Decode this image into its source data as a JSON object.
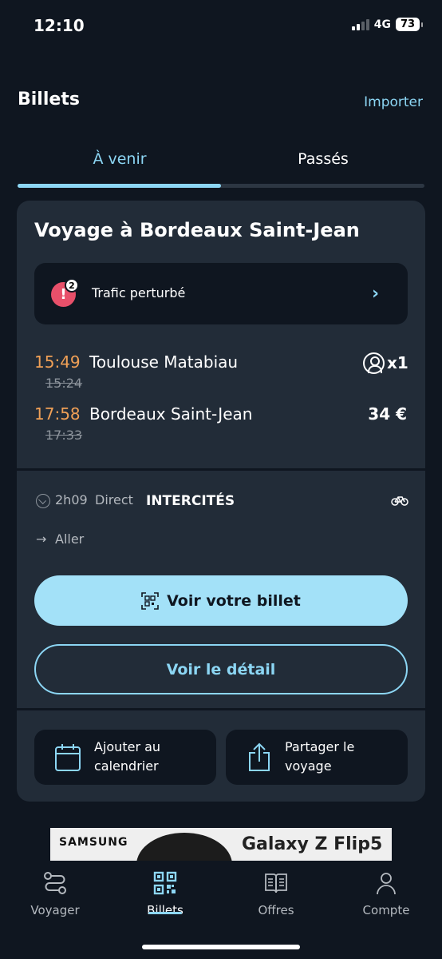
{
  "status_bar": {
    "time": "12:10",
    "network": "4G",
    "battery": "73"
  },
  "header": {
    "title": "Billets",
    "import_label": "Importer"
  },
  "tabs": [
    {
      "label": "À venir",
      "active": true
    },
    {
      "label": "Passés",
      "active": false
    }
  ],
  "trip": {
    "title": "Voyage à Bordeaux Saint-Jean",
    "alert": {
      "count": "2",
      "text": "Trafic perturbé"
    },
    "departure": {
      "time": "15:49",
      "scheduled_time": "15:24",
      "station": "Toulouse Matabiau"
    },
    "arrival": {
      "time": "17:58",
      "scheduled_time": "17:33",
      "station": "Bordeaux Saint-Jean"
    },
    "passengers": "x1",
    "price": "34 €",
    "duration": "2h09",
    "type": "Direct",
    "operator": "INTERCITÉS",
    "direction": "Aller",
    "primary_button": "Voir votre billet",
    "secondary_button": "Voir le détail",
    "actions": {
      "calendar": "Ajouter au calendrier",
      "share": "Partager le voyage"
    }
  },
  "ad": {
    "brand": "SAMSUNG",
    "product": "Galaxy Z Flip5"
  },
  "bottom_nav": [
    {
      "label": "Voyager",
      "icon": "route-icon"
    },
    {
      "label": "Billets",
      "icon": "qr-code-icon",
      "active": true
    },
    {
      "label": "Offres",
      "icon": "book-icon"
    },
    {
      "label": "Compte",
      "icon": "user-icon"
    }
  ],
  "colors": {
    "background": "#0f1620",
    "card": "#222c38",
    "accent": "#8cd6f4",
    "time_highlight": "#f0a056",
    "alert": "#e8506a"
  }
}
